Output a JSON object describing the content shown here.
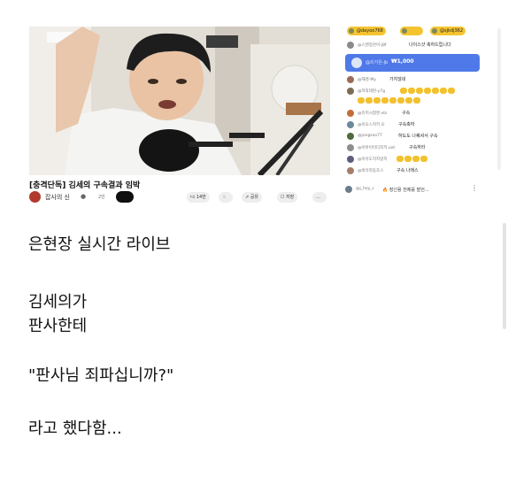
{
  "video": {
    "title": "[충격단독] 김세의 구속결과 임박",
    "channel_name": "잡사의 신",
    "subscriber_text": "2만",
    "actions": [
      "14만",
      "공유",
      "저장"
    ]
  },
  "chat": {
    "top_chips": [
      "@dayoo768",
      "",
      "@sjkdj362"
    ],
    "pinned": {
      "author": "@스텐장잔이-j8f",
      "text": "나이스샷 축하드립니다"
    },
    "super_chat": {
      "author": "@쇠가은-jb",
      "amount": "₩1,000"
    },
    "messages": [
      {
        "author": "@재경-My",
        "text": "가지않네",
        "emojis": 0
      },
      {
        "author": "@자악데현-y7g",
        "text": "",
        "emojis": 7
      },
      {
        "author": "",
        "text": "",
        "emojis": 8
      },
      {
        "author": "@유지시청면.vts",
        "text": "구속",
        "emojis": 0
      },
      {
        "author": "@이오스지키.오",
        "text": "구속축하",
        "emojis": 0
      },
      {
        "author": "@jungsoo77",
        "text": "하도도 나퀘셔서 구속",
        "emojis": 0
      },
      {
        "author": "@이아이미디지키.uxt",
        "text": "구속하라",
        "emojis": 0
      },
      {
        "author": "@이유도지지방지",
        "text": "",
        "emojis": 4
      },
      {
        "author": "@박유라동호스",
        "text": "구속 나에스",
        "emojis": 0
      }
    ],
    "input": {
      "author": "@j_hoy_c",
      "text": "🔥 장신용 전제를 발언..."
    }
  },
  "post": {
    "lines": [
      "은현장 실시간 라이브",
      "김세의가",
      "판사한테",
      "\"판사님 죄파십니까?\"",
      "라고 했다함..."
    ]
  }
}
